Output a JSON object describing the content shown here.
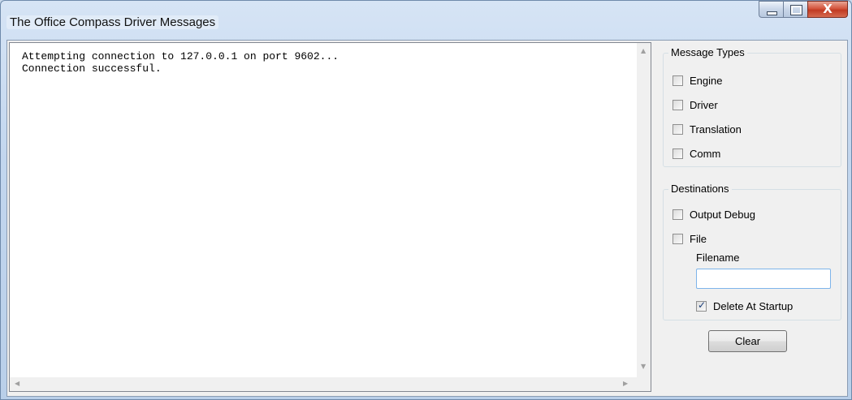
{
  "window": {
    "title": "The Office Compass Driver Messages",
    "controls": {
      "minimize": "minimize",
      "maximize": "maximize",
      "close": "X"
    }
  },
  "log": {
    "text": "Attempting connection to 127.0.0.1 on port 9602...\nConnection successful."
  },
  "message_types": {
    "label": "Message Types",
    "items": [
      {
        "label": "Engine",
        "checked": false
      },
      {
        "label": "Driver",
        "checked": false
      },
      {
        "label": "Translation",
        "checked": false
      },
      {
        "label": "Comm",
        "checked": false
      }
    ]
  },
  "destinations": {
    "label": "Destinations",
    "output_debug": {
      "label": "Output Debug",
      "checked": false
    },
    "file": {
      "label": "File",
      "checked": false
    },
    "filename_label": "Filename",
    "filename_value": "",
    "delete_at_startup": {
      "label": "Delete At Startup",
      "checked": true
    }
  },
  "clear_button": "Clear",
  "icons": {
    "scroll_up": "up-arrow-icon",
    "scroll_down": "down-arrow-icon",
    "scroll_left": "left-arrow-icon",
    "scroll_right": "right-arrow-icon"
  }
}
